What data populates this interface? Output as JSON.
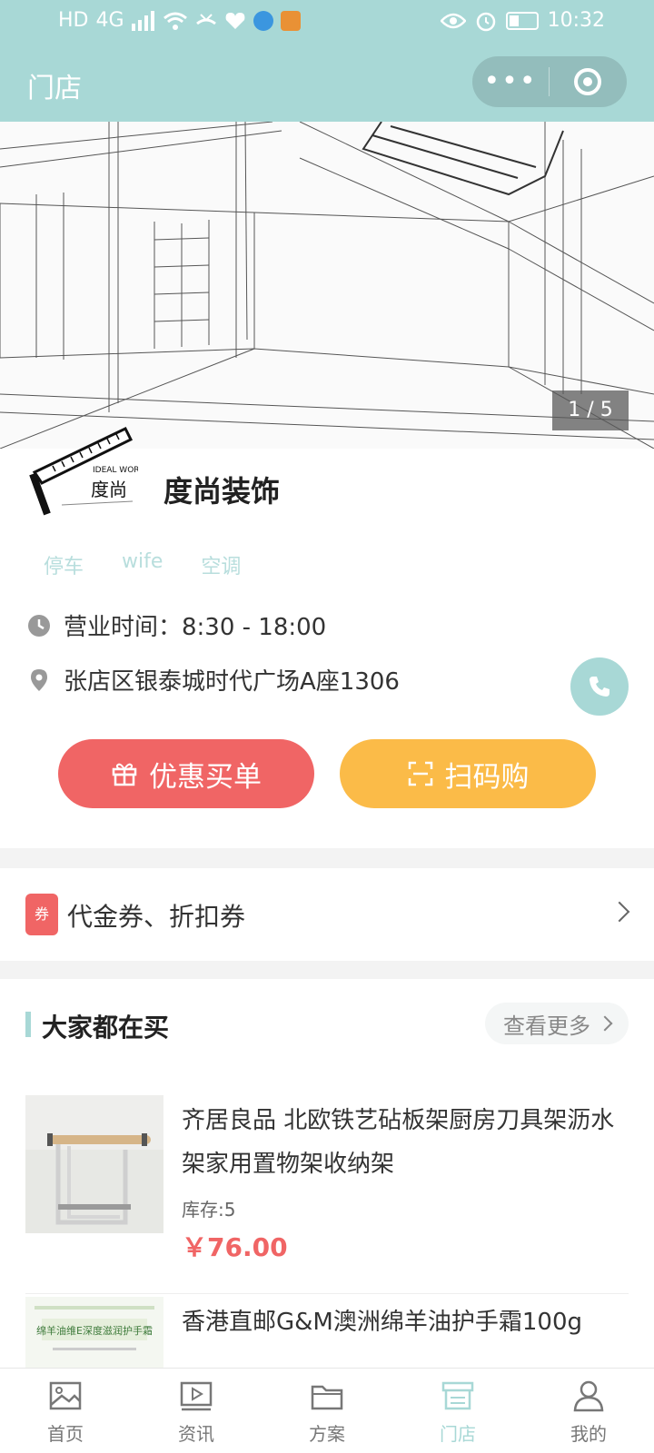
{
  "status_bar": {
    "network_label": "HD",
    "signal_label": "4G",
    "time": "10:32"
  },
  "nav": {
    "title": "门店",
    "more_label": "•••"
  },
  "banner": {
    "pager": "1 / 5"
  },
  "store": {
    "name": "度尚装饰",
    "logo_text": "IDEAL WORLD",
    "logo_subtext": "度尚",
    "tags": [
      "停车",
      "wife",
      "空调"
    ],
    "hours": "营业时间：8:30 - 18:00",
    "address": "张店区银泰城时代广场A座1306",
    "discount_button": "优惠买单",
    "scan_button": "扫码购"
  },
  "coupon": {
    "badge": "券",
    "label": "代金券、折扣券"
  },
  "section": {
    "title": "大家都在买",
    "more": "查看更多"
  },
  "products": [
    {
      "title": "齐居良品 北欧铁艺砧板架厨房刀具架沥水架家用置物架收纳架",
      "stock": "库存:5",
      "price": "￥76.00"
    },
    {
      "title": "香港直邮G&M澳洲绵羊油护手霜100g",
      "image_text": "绵羊油维E深度滋润护手霜"
    }
  ],
  "tabbar": [
    {
      "label": "首页",
      "icon": "image-icon",
      "active": false
    },
    {
      "label": "资讯",
      "icon": "video-icon",
      "active": false
    },
    {
      "label": "方案",
      "icon": "folder-icon",
      "active": false
    },
    {
      "label": "门店",
      "icon": "store-icon",
      "active": true
    },
    {
      "label": "我的",
      "icon": "user-icon",
      "active": false
    }
  ],
  "colors": {
    "theme": "#a8d8d6",
    "discount": "#f06565",
    "scan": "#fbbb48",
    "price": "#f06565"
  }
}
